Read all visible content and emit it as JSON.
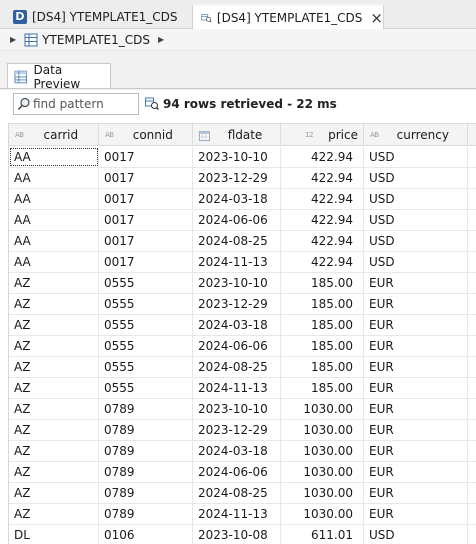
{
  "tabs": [
    {
      "label": "[DS4] YTEMPLATE1_CDS",
      "active": false
    },
    {
      "label": "[DS4] YTEMPLATE1_CDS",
      "active": true,
      "close": "×"
    }
  ],
  "breadcrumb": {
    "item": "YTEMPLATE1_CDS"
  },
  "panel": {
    "tab_label": "Data Preview"
  },
  "toolbar": {
    "search_placeholder": "find pattern",
    "status": "94 rows retrieved - 22 ms"
  },
  "table": {
    "columns": [
      {
        "label": "carrid",
        "type_icon": "AB"
      },
      {
        "label": "connid",
        "type_icon": "AB"
      },
      {
        "label": "fldate",
        "type_icon": "calendar-icon"
      },
      {
        "label": "price",
        "type_icon": "12"
      },
      {
        "label": "currency",
        "type_icon": "AB"
      }
    ],
    "rows": [
      {
        "carrid": "AA",
        "connid": "0017",
        "fldate": "2023-10-10",
        "price": "422.94",
        "currency": "USD"
      },
      {
        "carrid": "AA",
        "connid": "0017",
        "fldate": "2023-12-29",
        "price": "422.94",
        "currency": "USD"
      },
      {
        "carrid": "AA",
        "connid": "0017",
        "fldate": "2024-03-18",
        "price": "422.94",
        "currency": "USD"
      },
      {
        "carrid": "AA",
        "connid": "0017",
        "fldate": "2024-06-06",
        "price": "422.94",
        "currency": "USD"
      },
      {
        "carrid": "AA",
        "connid": "0017",
        "fldate": "2024-08-25",
        "price": "422.94",
        "currency": "USD"
      },
      {
        "carrid": "AA",
        "connid": "0017",
        "fldate": "2024-11-13",
        "price": "422.94",
        "currency": "USD"
      },
      {
        "carrid": "AZ",
        "connid": "0555",
        "fldate": "2023-10-10",
        "price": "185.00",
        "currency": "EUR"
      },
      {
        "carrid": "AZ",
        "connid": "0555",
        "fldate": "2023-12-29",
        "price": "185.00",
        "currency": "EUR"
      },
      {
        "carrid": "AZ",
        "connid": "0555",
        "fldate": "2024-03-18",
        "price": "185.00",
        "currency": "EUR"
      },
      {
        "carrid": "AZ",
        "connid": "0555",
        "fldate": "2024-06-06",
        "price": "185.00",
        "currency": "EUR"
      },
      {
        "carrid": "AZ",
        "connid": "0555",
        "fldate": "2024-08-25",
        "price": "185.00",
        "currency": "EUR"
      },
      {
        "carrid": "AZ",
        "connid": "0555",
        "fldate": "2024-11-13",
        "price": "185.00",
        "currency": "EUR"
      },
      {
        "carrid": "AZ",
        "connid": "0789",
        "fldate": "2023-10-10",
        "price": "1030.00",
        "currency": "EUR"
      },
      {
        "carrid": "AZ",
        "connid": "0789",
        "fldate": "2023-12-29",
        "price": "1030.00",
        "currency": "EUR"
      },
      {
        "carrid": "AZ",
        "connid": "0789",
        "fldate": "2024-03-18",
        "price": "1030.00",
        "currency": "EUR"
      },
      {
        "carrid": "AZ",
        "connid": "0789",
        "fldate": "2024-06-06",
        "price": "1030.00",
        "currency": "EUR"
      },
      {
        "carrid": "AZ",
        "connid": "0789",
        "fldate": "2024-08-25",
        "price": "1030.00",
        "currency": "EUR"
      },
      {
        "carrid": "AZ",
        "connid": "0789",
        "fldate": "2024-11-13",
        "price": "1030.00",
        "currency": "EUR"
      },
      {
        "carrid": "DL",
        "connid": "0106",
        "fldate": "2023-10-08",
        "price": "611.01",
        "currency": "USD"
      }
    ]
  }
}
